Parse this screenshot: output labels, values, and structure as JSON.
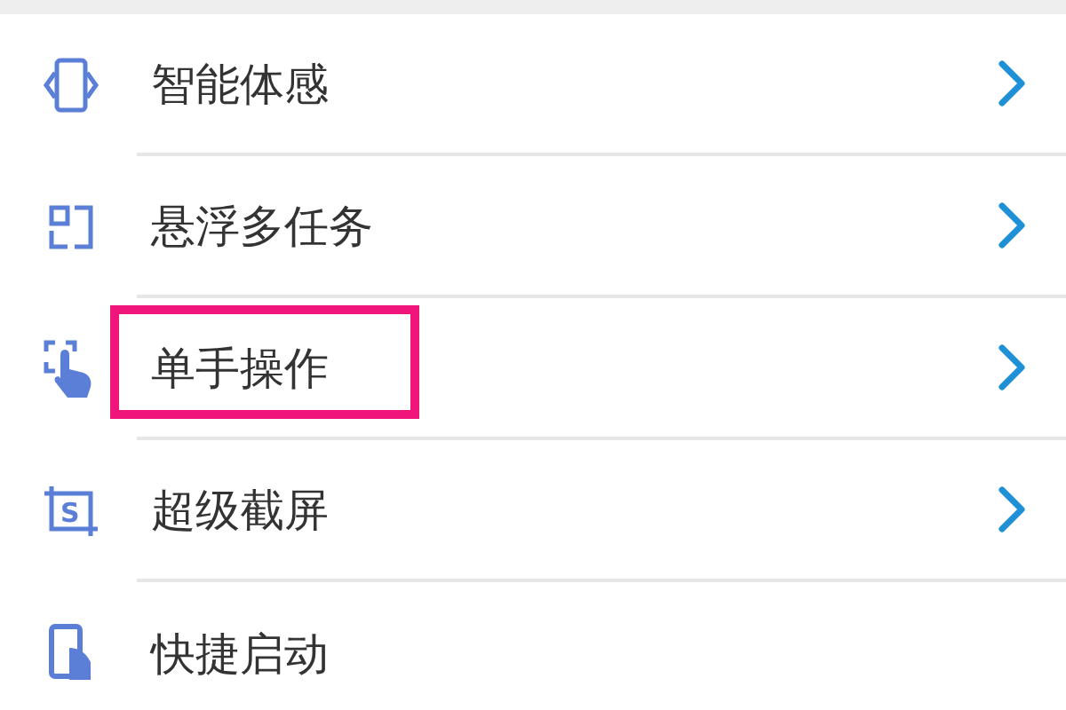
{
  "settings": [
    {
      "label": "智能体感",
      "kind": "rotate",
      "chevron": true,
      "highlighted": false
    },
    {
      "label": "悬浮多任务",
      "kind": "windows",
      "chevron": true,
      "highlighted": false
    },
    {
      "label": "单手操作",
      "kind": "hand",
      "chevron": true,
      "highlighted": true
    },
    {
      "label": "超级截屏",
      "kind": "screenshot",
      "icon_text": "S",
      "chevron": true,
      "highlighted": false
    },
    {
      "label": "快捷启动",
      "kind": "phone",
      "chevron": false,
      "highlighted": false
    }
  ]
}
